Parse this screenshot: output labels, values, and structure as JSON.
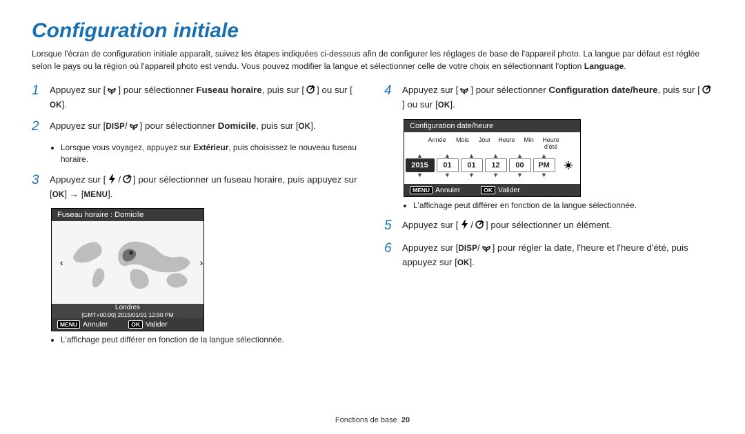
{
  "title": "Configuration initiale",
  "intro_prefix": "Lorsque l'écran de configuration initiale apparaît, suivez les étapes indiquées ci-dessous afin de configurer les réglages de base de l'appareil photo. La langue par défaut est réglée selon le pays ou la région où l'appareil photo est vendu. Vous pouvez modifier la langue et sélectionner celle de votre choix en sélectionnant l'option ",
  "intro_bold": "Language",
  "intro_suffix": ".",
  "icons": {
    "macro": "macro-icon",
    "timer": "timer-icon",
    "ok": "OK",
    "disp": "DISP",
    "menu": "MENU",
    "flash": "flash-icon",
    "dst": "dst-icon"
  },
  "steps_left": [
    {
      "n": "1",
      "parts": [
        "Appuyez sur [",
        {
          "icon": "macro"
        },
        "] pour sélectionner ",
        {
          "b": "Fuseau horaire"
        },
        ", puis sur [",
        {
          "icon": "timer"
        },
        "] ou sur [",
        {
          "key": "OK"
        },
        "]."
      ]
    },
    {
      "n": "2",
      "parts": [
        "Appuyez sur [",
        {
          "key": "DISP"
        },
        "/",
        {
          "icon": "macro"
        },
        "] pour sélectionner ",
        {
          "b": "Domicile"
        },
        ", puis sur [",
        {
          "key": "OK"
        },
        "]."
      ],
      "bullets": [
        "Lorsque vous voyagez, appuyez sur ",
        {
          "b": "Extérieur"
        },
        ", puis choisissez le nouveau fuseau horaire."
      ]
    },
    {
      "n": "3",
      "parts": [
        "Appuyez sur [",
        {
          "icon": "flash"
        },
        "/",
        {
          "icon": "timer"
        },
        "] pour sélectionner un fuseau horaire, puis appuyez sur [",
        {
          "key": "OK"
        },
        "] → [",
        {
          "key": "MENU"
        },
        "]."
      ]
    }
  ],
  "tz_panel": {
    "title": "Fuseau horaire : Domicile",
    "city": "Londres",
    "stamp": "[GMT+00:00] 2015/01/01 12:00 PM",
    "cancel_key": "MENU",
    "cancel": "Annuler",
    "ok_key": "OK",
    "ok": "Valider"
  },
  "left_note": "L'affichage peut différer en fonction de la langue sélectionnée.",
  "steps_right": [
    {
      "n": "4",
      "parts": [
        "Appuyez sur [",
        {
          "icon": "macro"
        },
        "] pour sélectionner ",
        {
          "b": "Configuration date/heure"
        },
        ", puis sur [",
        {
          "icon": "timer"
        },
        "] ou sur [",
        {
          "key": "OK"
        },
        "]."
      ]
    }
  ],
  "date_panel": {
    "title": "Configuration date/heure",
    "labels": [
      "Année",
      "Mois",
      "Jour",
      "Heure",
      "Min",
      "Heure d'été"
    ],
    "values": [
      "2015",
      "01",
      "01",
      "12",
      "00",
      "PM"
    ],
    "selected_index": 0,
    "cancel_key": "MENU",
    "cancel": "Annuler",
    "ok_key": "OK",
    "ok": "Valider"
  },
  "right_note": "L'affichage peut différer en fonction de la langue sélectionnée.",
  "steps_right2": [
    {
      "n": "5",
      "parts": [
        "Appuyez sur [",
        {
          "icon": "flash"
        },
        "/",
        {
          "icon": "timer"
        },
        "] pour sélectionner un élément."
      ]
    },
    {
      "n": "6",
      "parts": [
        "Appuyez sur [",
        {
          "key": "DISP"
        },
        "/",
        {
          "icon": "macro"
        },
        "] pour régler la date, l'heure et l'heure d'été, puis appuyez sur [",
        {
          "key": "OK"
        },
        "]."
      ]
    }
  ],
  "footer": {
    "section": "Fonctions de base",
    "page": "20"
  }
}
